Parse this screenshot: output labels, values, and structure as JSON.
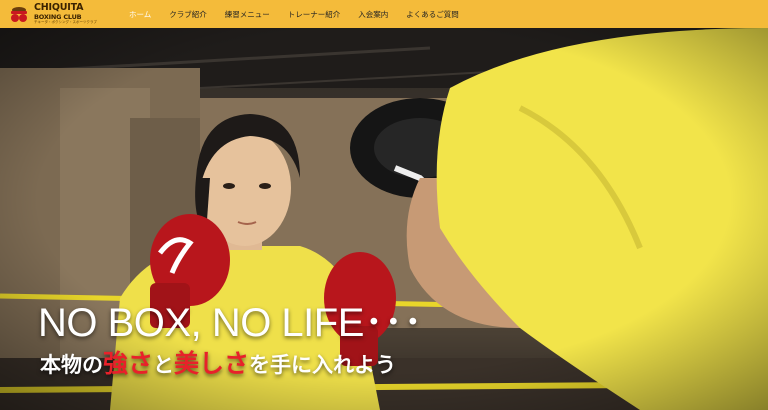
{
  "header": {
    "logo": {
      "name_line1": "CHIQUITA",
      "name_line2": "BOXING CLUB",
      "name_line3": "チキータ・ボクシング・スポーツクラブ"
    },
    "nav": [
      {
        "label": "ホーム",
        "active": true
      },
      {
        "label": "クラブ紹介"
      },
      {
        "label": "練習メニュー"
      },
      {
        "label": "トレーナー紹介"
      },
      {
        "label": "入会案内"
      },
      {
        "label": "よくあるご質問"
      }
    ]
  },
  "hero": {
    "headline": "NO BOX, NO LIFE･･･",
    "tagline": {
      "part1": "本物の",
      "accent1": "強さ",
      "part2": "と",
      "accent2": "美しさ",
      "part3": "を手に入れよう"
    }
  },
  "colors": {
    "header_bg": "#f4bb3a",
    "accent_red": "#e8212a",
    "text_white": "#ffffff",
    "glove_red": "#b8161c",
    "shirt_yellow": "#f2e44a"
  }
}
